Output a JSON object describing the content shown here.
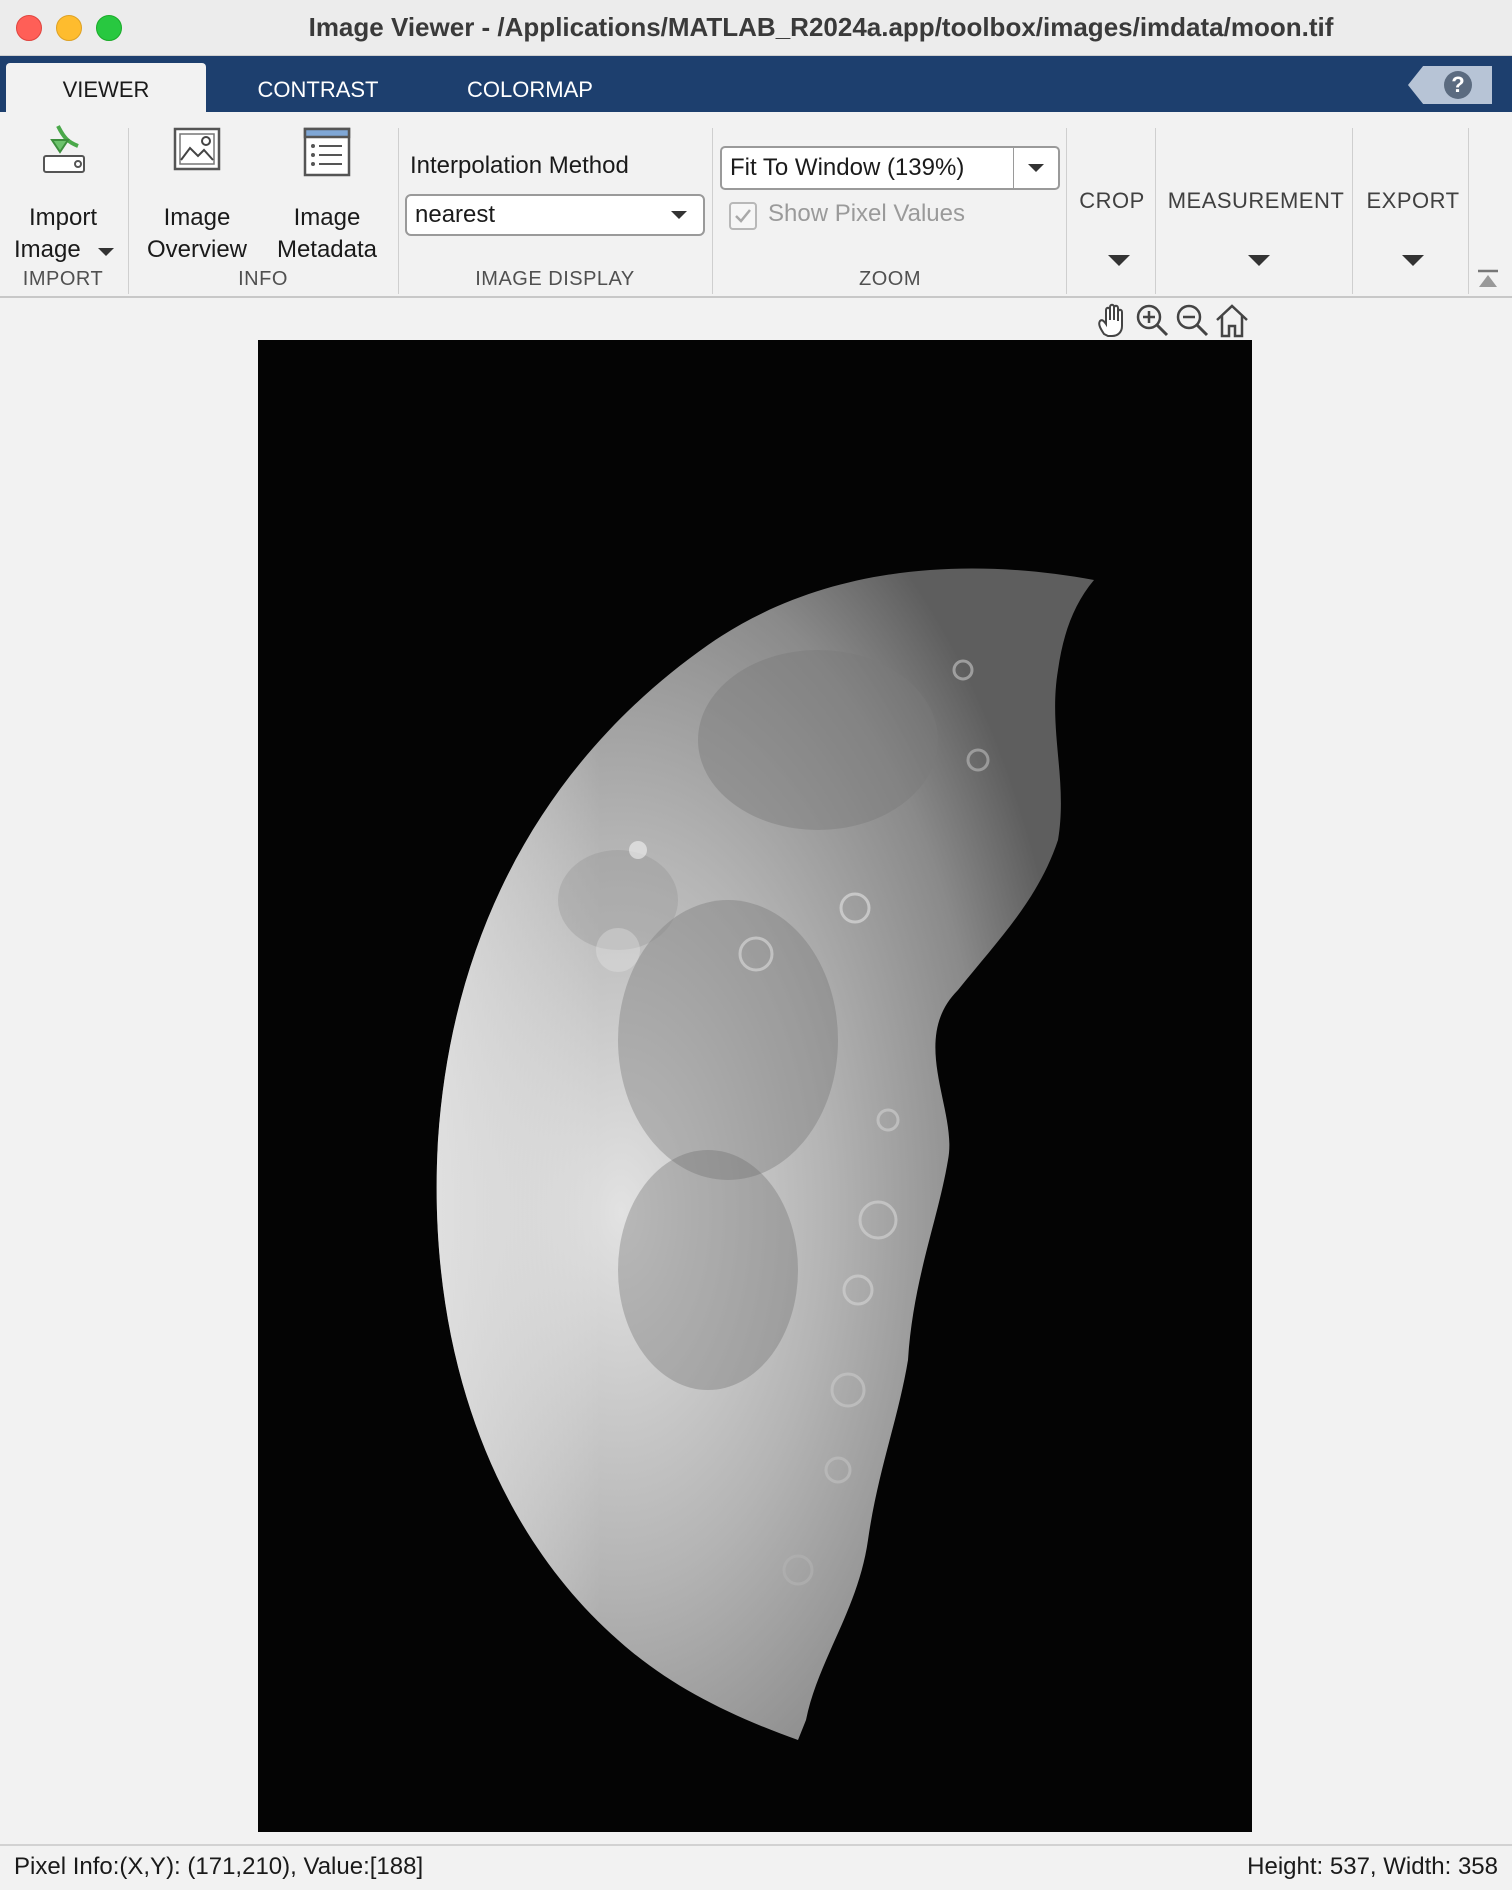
{
  "window": {
    "title": "Image Viewer - /Applications/MATLAB_R2024a.app/toolbox/images/imdata/moon.tif"
  },
  "tabs": [
    {
      "label": "VIEWER",
      "active": true
    },
    {
      "label": "CONTRAST",
      "active": false
    },
    {
      "label": "COLORMAP",
      "active": false
    }
  ],
  "help": {
    "symbol": "?",
    "icon": "help-icon"
  },
  "toolstrip": {
    "import": {
      "button_line1": "Import",
      "button_line2": "Image",
      "section": "IMPORT",
      "icon": "import-image-icon"
    },
    "info": {
      "overview_line1": "Image",
      "overview_line2": "Overview",
      "metadata_line1": "Image",
      "metadata_line2": "Metadata",
      "section": "INFO"
    },
    "display": {
      "interp_label": "Interpolation Method",
      "interp_value": "nearest",
      "section": "IMAGE DISPLAY"
    },
    "zoom": {
      "value": "Fit To Window (139%)",
      "show_pixel_label": "Show Pixel Values",
      "show_pixel_checked": true,
      "section": "ZOOM"
    },
    "crop": {
      "label": "CROP"
    },
    "measurement": {
      "label": "MEASUREMENT"
    },
    "export": {
      "label": "EXPORT"
    }
  },
  "axes_toolbar": [
    "pan-hand-icon",
    "zoom-in-icon",
    "zoom-out-icon",
    "restore-view-home-icon"
  ],
  "status": {
    "pixel_info": "Pixel Info:(X,Y): (171,210), Value:[188]",
    "dimensions": "Height: 537, Width: 358"
  },
  "colors": {
    "tab_strip": "#1d3f6e",
    "toolstrip_bg": "#f2f2f2",
    "image_bg": "#040404"
  }
}
